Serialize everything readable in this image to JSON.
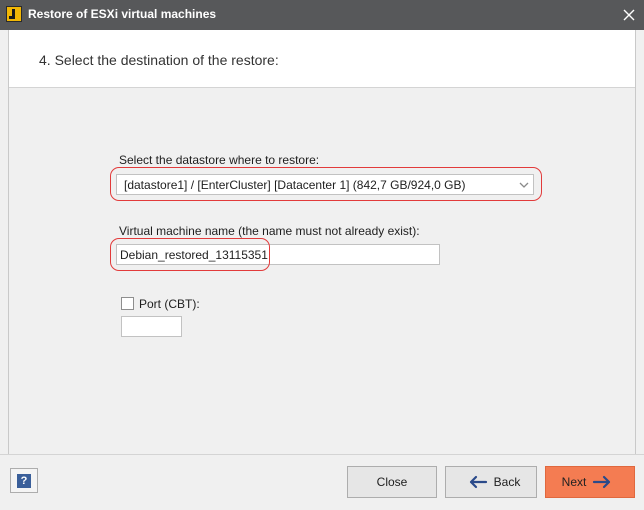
{
  "window": {
    "title": "Restore of ESXi virtual machines",
    "close_glyph": "✕"
  },
  "wizard": {
    "step_title": "4. Select the destination of the restore:"
  },
  "datastore": {
    "label": "Select the datastore where to restore:",
    "selected_value": "[datastore1] / [EnterCluster] [Datacenter 1] (842,7 GB/924,0 GB)"
  },
  "vm_name": {
    "label": "Virtual machine name (the name must not already exist):",
    "value": "Debian_restored_13115351"
  },
  "port": {
    "label": "Port (CBT):",
    "checked": false,
    "value": ""
  },
  "footer": {
    "help_glyph": "?",
    "close_label": "Close",
    "back_label": "Back",
    "next_label": "Next"
  },
  "colors": {
    "titlebar": "#57585a",
    "highlight": "#e23b3b",
    "next_button": "#f47c52",
    "arrow_blue": "#2a4a8a"
  },
  "icons": [
    "app-logo-icon",
    "close-icon",
    "chevron-down-icon",
    "help-icon",
    "arrow-left-icon",
    "arrow-right-icon"
  ]
}
